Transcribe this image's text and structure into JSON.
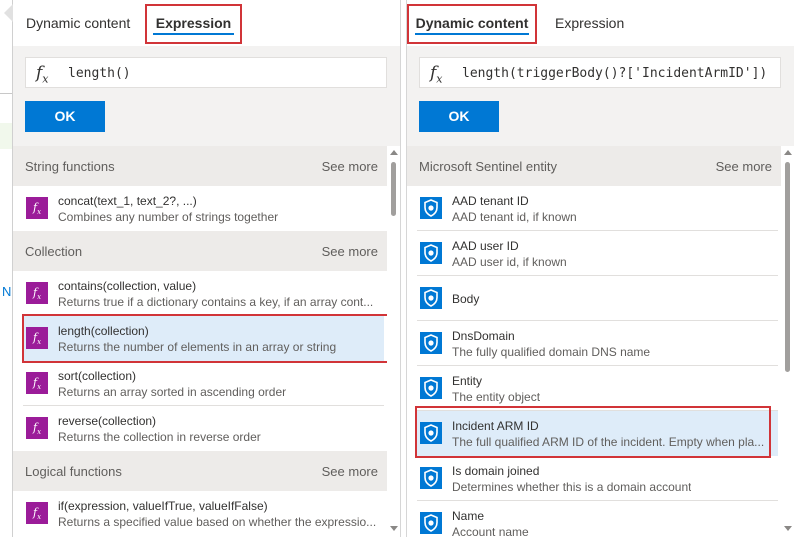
{
  "left_panel": {
    "tabs": [
      {
        "label": "Dynamic content",
        "active": false
      },
      {
        "label": "Expression",
        "active": true
      }
    ],
    "expression": {
      "fx": "f",
      "fx_sub": "x",
      "value": "length()"
    },
    "ok_label": "OK",
    "sections": [
      {
        "title": "String functions",
        "see_more": "See more",
        "items": [
          {
            "title": "concat(text_1, text_2?, ...)",
            "desc": "Combines any number of strings together"
          }
        ]
      },
      {
        "title": "Collection",
        "see_more": "See more",
        "items": [
          {
            "title": "contains(collection, value)",
            "desc": "Returns true if a dictionary contains a key, if an array cont..."
          },
          {
            "title": "length(collection)",
            "desc": "Returns the number of elements in an array or string"
          },
          {
            "title": "sort(collection)",
            "desc": "Returns an array sorted in ascending order"
          },
          {
            "title": "reverse(collection)",
            "desc": "Returns the collection in reverse order"
          }
        ]
      },
      {
        "title": "Logical functions",
        "see_more": "See more",
        "items": [
          {
            "title": "if(expression, valueIfTrue, valueIfFalse)",
            "desc": "Returns a specified value based on whether the expressio..."
          }
        ]
      }
    ]
  },
  "right_panel": {
    "tabs": [
      {
        "label": "Dynamic content",
        "active": true
      },
      {
        "label": "Expression",
        "active": false
      }
    ],
    "expression": {
      "fx": "f",
      "fx_sub": "x",
      "value": "length(triggerBody()?['IncidentArmID'])"
    },
    "ok_label": "OK",
    "section": {
      "title": "Microsoft Sentinel entity",
      "see_more": "See more"
    },
    "items": [
      {
        "title": "AAD tenant ID",
        "desc": "AAD tenant id, if known"
      },
      {
        "title": "AAD user ID",
        "desc": "AAD user id, if known"
      },
      {
        "title": "Body",
        "desc": ""
      },
      {
        "title": "DnsDomain",
        "desc": "The fully qualified domain DNS name"
      },
      {
        "title": "Entity",
        "desc": "The entity object"
      },
      {
        "title": "Incident ARM ID",
        "desc": "The full qualified ARM ID of the incident. Empty when pla..."
      },
      {
        "title": "Is domain joined",
        "desc": "Determines whether this is a domain account"
      },
      {
        "title": "Name",
        "desc": "Account name"
      }
    ]
  },
  "background": {
    "partial_text": "N"
  },
  "colors": {
    "accent": "#0078d4",
    "highlight": "#d13438",
    "fx_icon": "#9b1c99",
    "selected_row": "#deecf9"
  }
}
